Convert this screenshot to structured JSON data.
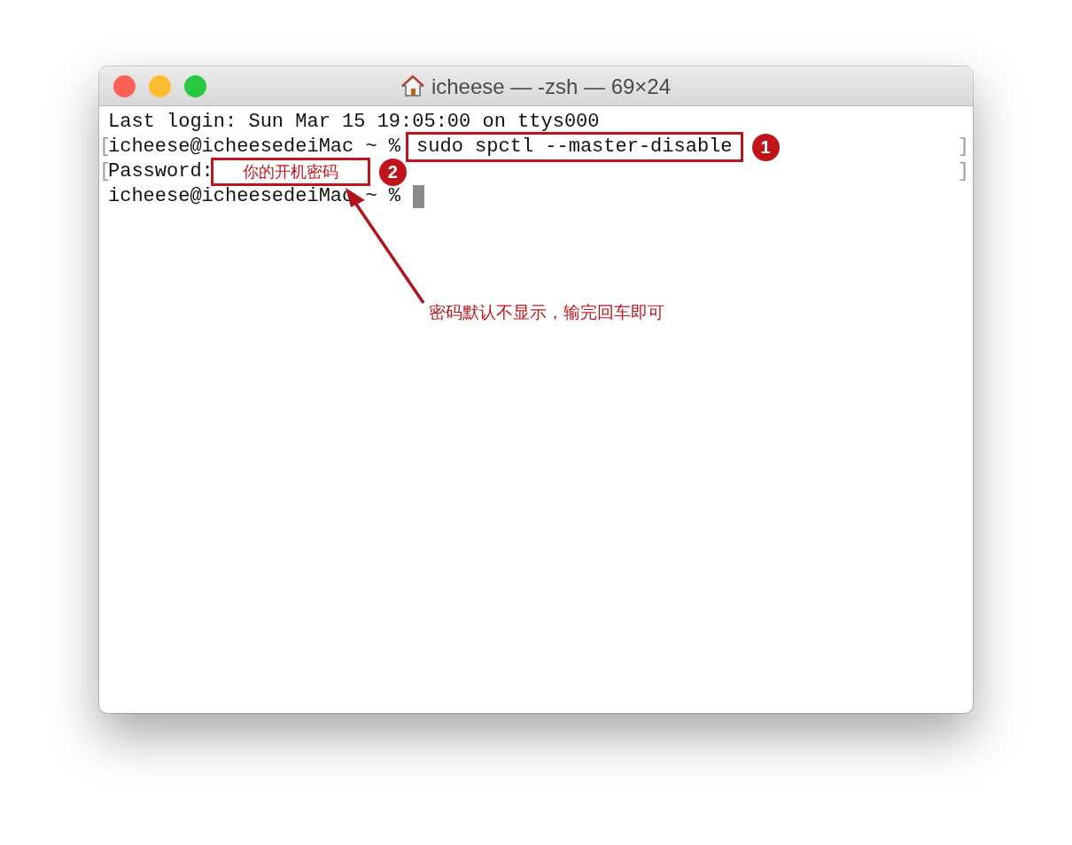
{
  "window": {
    "title": "icheese — -zsh — 69×24"
  },
  "lines": [
    {
      "kind": "output",
      "text": "Last login: Sun Mar 15 19:05:00 on ttys000"
    },
    {
      "kind": "prompt",
      "left_bracket": "[",
      "prompt": "icheese@icheesedeiMac ~ %",
      "input": "sudo spctl --master-disable",
      "badge": "1",
      "right_bracket": "]"
    },
    {
      "kind": "password",
      "left_bracket": "[",
      "prompt": "Password:",
      "input": "你的开机密码",
      "badge": "2",
      "right_bracket": "]"
    },
    {
      "kind": "prompt",
      "prompt": "icheese@icheesedeiMac ~ %",
      "cursor": true
    }
  ],
  "callout": {
    "text": "密码默认不显示，输完回车即可"
  }
}
